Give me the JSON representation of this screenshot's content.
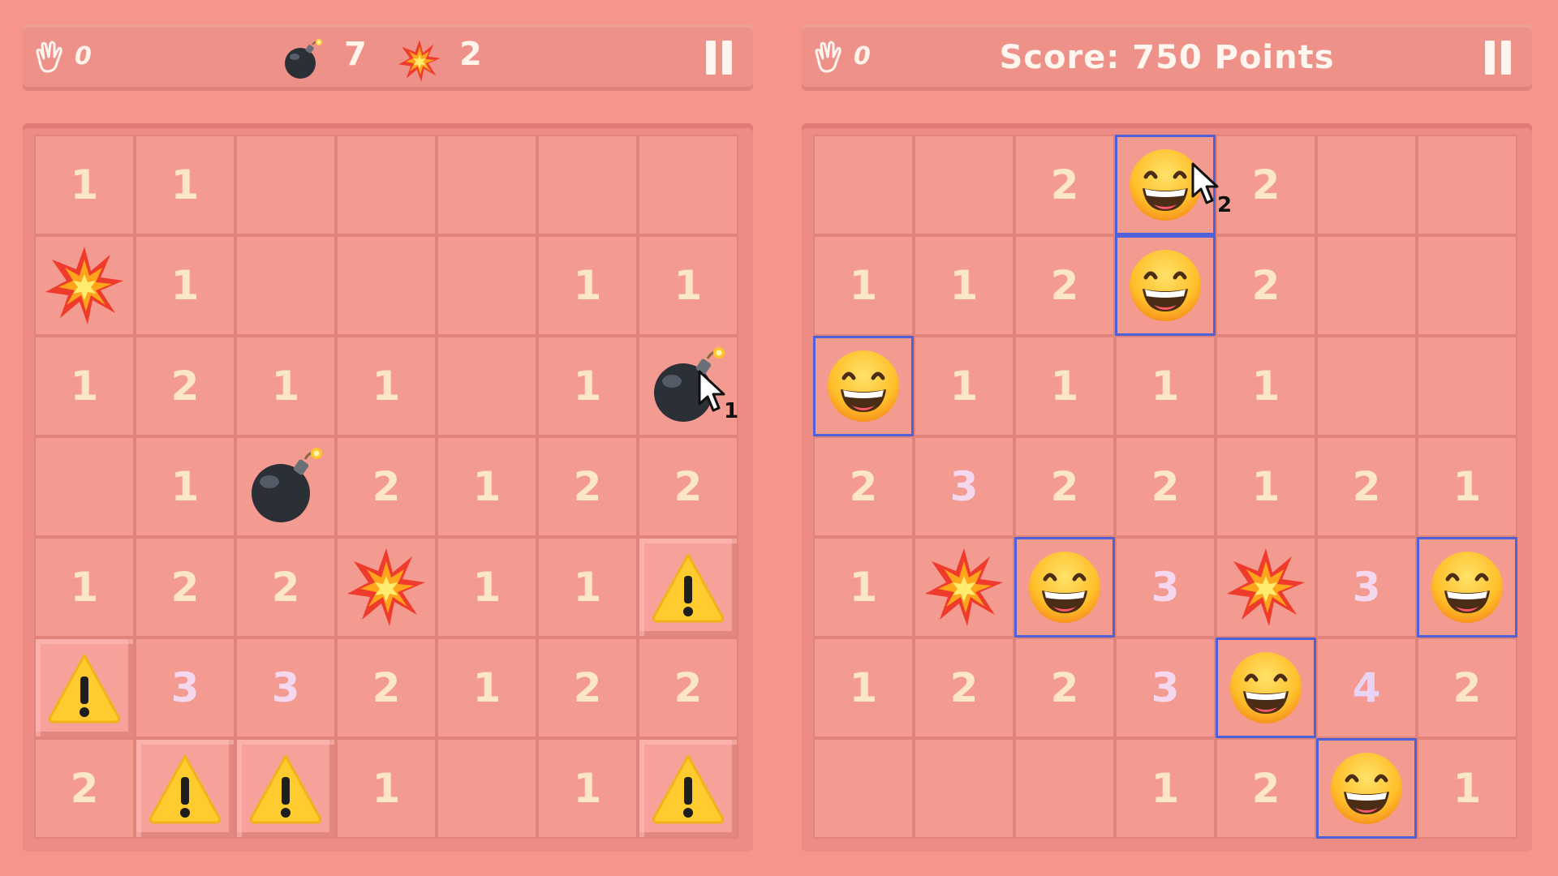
{
  "left": {
    "hand_count": "0",
    "bomb_count": "7",
    "blast_count": "2",
    "cursor_label": "1",
    "grid": [
      [
        "1",
        "1",
        "",
        "",
        "",
        "",
        ""
      ],
      [
        "blast",
        "1",
        "",
        "",
        "",
        "1",
        "1"
      ],
      [
        "1",
        "2",
        "1",
        "1",
        "",
        "1",
        "bomb"
      ],
      [
        "",
        "1",
        "bomb",
        "2",
        "1",
        "2",
        "2"
      ],
      [
        "1",
        "2",
        "2",
        "blast",
        "1",
        "1",
        "warn"
      ],
      [
        "warn",
        "3",
        "3",
        "2",
        "1",
        "2",
        "2"
      ],
      [
        "2",
        "warn",
        "warn",
        "1",
        "",
        "1",
        "warn"
      ]
    ]
  },
  "right": {
    "hand_count": "0",
    "score_text": "Score: 750 Points",
    "cursor_label": "2",
    "grid": [
      [
        "",
        "",
        "2",
        "smile",
        "2",
        "",
        ""
      ],
      [
        "1",
        "1",
        "2",
        "smile",
        "2",
        "",
        ""
      ],
      [
        "smile",
        "1",
        "1",
        "1",
        "1",
        "",
        ""
      ],
      [
        "2",
        "3",
        "2",
        "2",
        "1",
        "2",
        "1"
      ],
      [
        "1",
        "blast",
        "smile",
        "3",
        "blast",
        "3",
        "smile"
      ],
      [
        "1",
        "2",
        "2",
        "3",
        "smile",
        "4",
        "2"
      ],
      [
        "",
        "",
        "",
        "1",
        "2",
        "smile",
        "1"
      ]
    ]
  },
  "icons": {
    "bomb": "bomb-icon",
    "blast": "explosion-icon",
    "warn": "warning-icon",
    "smile": "grinning-face-icon",
    "hand": "hand-icon",
    "pause": "pause-icon"
  },
  "colors": {
    "background": "#f6958c",
    "highlight": "#4f61d8",
    "number": "#fce6c8"
  }
}
